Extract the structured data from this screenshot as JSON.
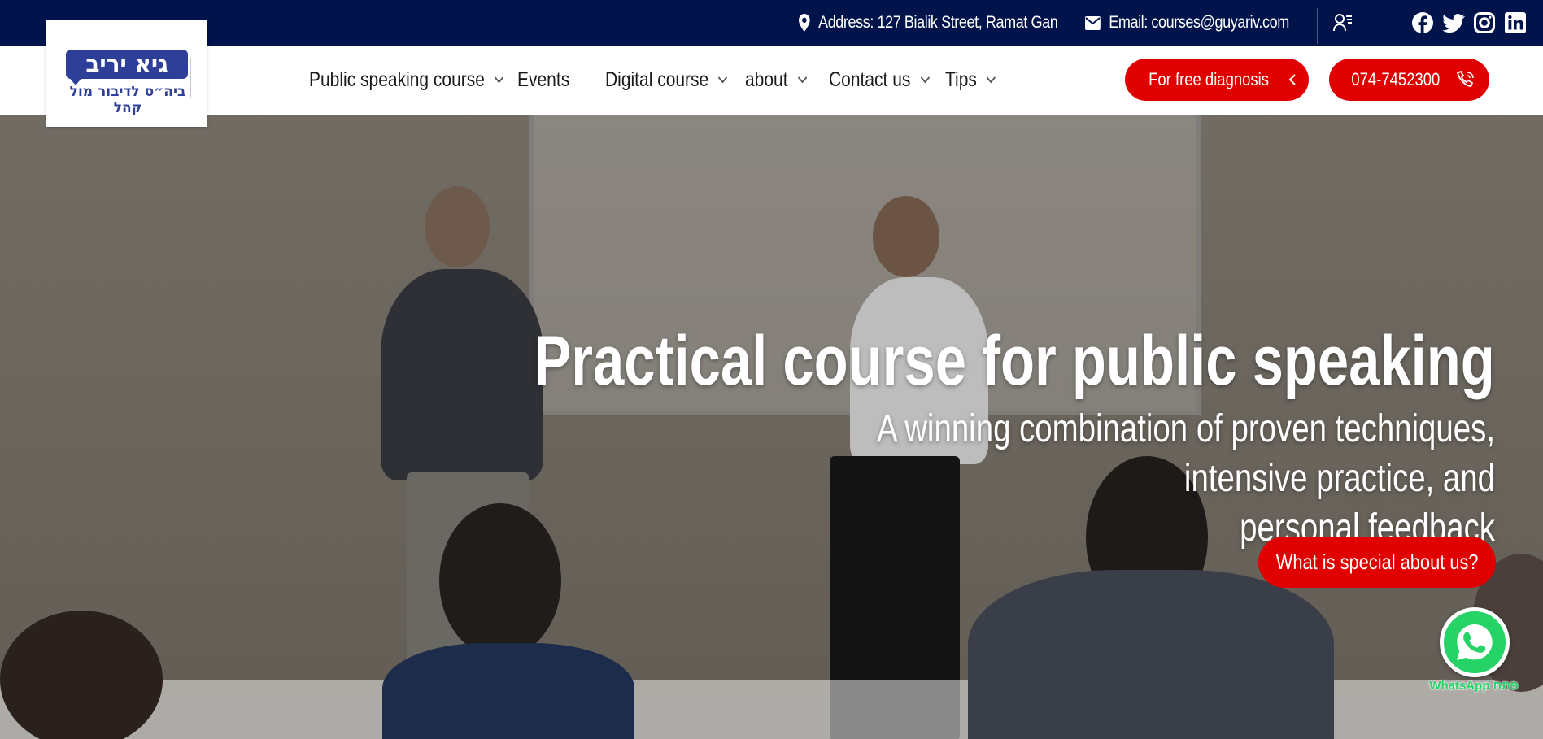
{
  "topbar": {
    "address": "Address: 127 Bialik Street, Ramat Gan",
    "email": "Email: courses@guyariv.com",
    "icons": [
      "location-pin-icon",
      "envelope-icon",
      "user-list-icon",
      "facebook-icon",
      "twitter-icon",
      "instagram-icon",
      "linkedin-icon"
    ]
  },
  "logo": {
    "name": "גיא יריב",
    "tagline": "ביה״ס לדיבור מול קהל"
  },
  "nav": {
    "items": [
      {
        "label": "Public speaking course",
        "has_dropdown": true
      },
      {
        "label": "Events",
        "has_dropdown": false
      },
      {
        "label": "Digital course",
        "has_dropdown": true
      },
      {
        "label": "about",
        "has_dropdown": true
      },
      {
        "label": "Contact us",
        "has_dropdown": true
      },
      {
        "label": "Tips",
        "has_dropdown": true
      }
    ],
    "diagnosis_button": "For free diagnosis",
    "phone_button": "074-7452300"
  },
  "hero": {
    "title": "Practical course for public speaking",
    "subtitle_line1": "A winning combination of proven techniques, intensive practice, and",
    "subtitle_line2": "personal feedback",
    "cta": "What is special about us?"
  },
  "whatsapp": {
    "label": "WhatsApp פתח"
  },
  "colors": {
    "topbar": "#00134b",
    "accent_red": "#e00000",
    "logo_blue": "#2e3f99",
    "whatsapp_green": "#25d366"
  }
}
